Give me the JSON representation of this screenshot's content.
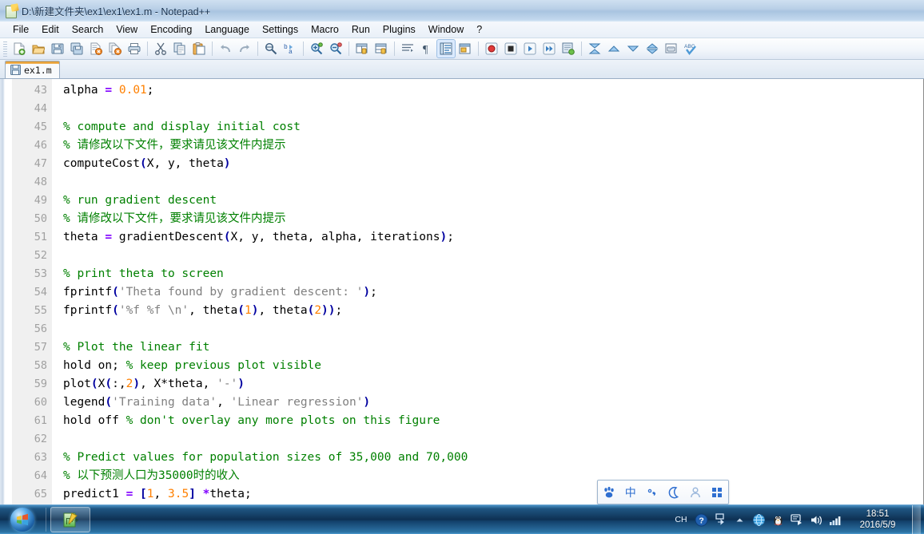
{
  "window": {
    "title": "D:\\新建文件夹\\ex1\\ex1\\ex1.m - Notepad++",
    "icon": "notepad-plus-plus-icon"
  },
  "menu": {
    "items": [
      {
        "label": "File"
      },
      {
        "label": "Edit"
      },
      {
        "label": "Search"
      },
      {
        "label": "View"
      },
      {
        "label": "Encoding"
      },
      {
        "label": "Language"
      },
      {
        "label": "Settings"
      },
      {
        "label": "Macro"
      },
      {
        "label": "Run"
      },
      {
        "label": "Plugins"
      },
      {
        "label": "Window"
      },
      {
        "label": "?"
      }
    ]
  },
  "toolbar": {
    "buttons": [
      {
        "name": "new-file-icon",
        "tip": "New"
      },
      {
        "name": "open-file-icon",
        "tip": "Open"
      },
      {
        "name": "save-icon",
        "tip": "Save"
      },
      {
        "name": "save-all-icon",
        "tip": "Save All"
      },
      {
        "name": "close-file-icon",
        "tip": "Close"
      },
      {
        "name": "close-all-icon",
        "tip": "Close All"
      },
      {
        "name": "print-icon",
        "tip": "Print"
      },
      {
        "name": "cut-icon",
        "tip": "Cut"
      },
      {
        "name": "copy-icon",
        "tip": "Copy"
      },
      {
        "name": "paste-icon",
        "tip": "Paste"
      },
      {
        "name": "undo-icon",
        "tip": "Undo"
      },
      {
        "name": "redo-icon",
        "tip": "Redo"
      },
      {
        "name": "find-icon",
        "tip": "Find"
      },
      {
        "name": "replace-icon",
        "tip": "Replace"
      },
      {
        "name": "zoom-in-icon",
        "tip": "Zoom In"
      },
      {
        "name": "zoom-out-icon",
        "tip": "Zoom Out"
      },
      {
        "name": "sync-vertical-icon",
        "tip": "Synchronize Vertical Scrolling"
      },
      {
        "name": "sync-horizontal-icon",
        "tip": "Synchronize Horizontal Scrolling"
      },
      {
        "name": "word-wrap-icon",
        "tip": "Word Wrap"
      },
      {
        "name": "show-all-chars-icon",
        "tip": "Show All Characters"
      },
      {
        "name": "indent-guide-icon",
        "tip": "Show Indent Guide"
      },
      {
        "name": "user-defined-dialog-icon",
        "tip": "User-Defined Dialogue"
      },
      {
        "name": "record-macro-icon",
        "tip": "Start Recording"
      },
      {
        "name": "stop-macro-icon",
        "tip": "Stop Recording"
      },
      {
        "name": "play-macro-icon",
        "tip": "Playback"
      },
      {
        "name": "run-macro-multiple-icon",
        "tip": "Run a Macro Multiple Times"
      },
      {
        "name": "save-macro-icon",
        "tip": "Save Current Recorded Macro"
      },
      {
        "name": "collapse-all-icon",
        "tip": "Collapse All"
      },
      {
        "name": "collapse-level-icon",
        "tip": "Collapse Current Level"
      },
      {
        "name": "uncollapse-level-icon",
        "tip": "Uncollapse Current Level"
      },
      {
        "name": "expand-all-icon",
        "tip": "Expand All"
      },
      {
        "name": "show-untitled-icon",
        "tip": "Show All Characters"
      },
      {
        "name": "spell-check-icon",
        "tip": "Spell Check"
      }
    ]
  },
  "tabs": [
    {
      "label": "ex1.m",
      "icon": "saved-file-icon",
      "active": true
    }
  ],
  "editor": {
    "first_line": 43,
    "lines": [
      {
        "num": "43",
        "tokens": [
          {
            "t": "alpha ",
            "c": "c-def"
          },
          {
            "t": "=",
            "c": "c-op"
          },
          {
            "t": " ",
            "c": "c-def"
          },
          {
            "t": "0.01",
            "c": "c-num"
          },
          {
            "t": ";",
            "c": "c-def"
          }
        ]
      },
      {
        "num": "44",
        "tokens": []
      },
      {
        "num": "45",
        "tokens": [
          {
            "t": "% compute and display initial cost",
            "c": "c-com"
          }
        ]
      },
      {
        "num": "46",
        "tokens": [
          {
            "t": "% 请修改以下文件，要求请见该文件内提示",
            "c": "c-com"
          }
        ]
      },
      {
        "num": "47",
        "tokens": [
          {
            "t": "computeCost",
            "c": "c-def"
          },
          {
            "t": "(",
            "c": "c-par"
          },
          {
            "t": "X, y, theta",
            "c": "c-def"
          },
          {
            "t": ")",
            "c": "c-par"
          }
        ]
      },
      {
        "num": "48",
        "tokens": []
      },
      {
        "num": "49",
        "tokens": [
          {
            "t": "% run gradient descent",
            "c": "c-com"
          }
        ]
      },
      {
        "num": "50",
        "tokens": [
          {
            "t": "% 请修改以下文件，要求请见该文件内提示",
            "c": "c-com"
          }
        ]
      },
      {
        "num": "51",
        "tokens": [
          {
            "t": "theta ",
            "c": "c-def"
          },
          {
            "t": "=",
            "c": "c-op"
          },
          {
            "t": " gradientDescent",
            "c": "c-def"
          },
          {
            "t": "(",
            "c": "c-par"
          },
          {
            "t": "X, y, theta, alpha, iterations",
            "c": "c-def"
          },
          {
            "t": ")",
            "c": "c-par"
          },
          {
            "t": ";",
            "c": "c-def"
          }
        ]
      },
      {
        "num": "52",
        "tokens": []
      },
      {
        "num": "53",
        "tokens": [
          {
            "t": "% print theta to screen",
            "c": "c-com"
          }
        ]
      },
      {
        "num": "54",
        "tokens": [
          {
            "t": "fprintf",
            "c": "c-def"
          },
          {
            "t": "(",
            "c": "c-par"
          },
          {
            "t": "'Theta found by gradient descent: '",
            "c": "c-str"
          },
          {
            "t": ")",
            "c": "c-par"
          },
          {
            "t": ";",
            "c": "c-def"
          }
        ]
      },
      {
        "num": "55",
        "tokens": [
          {
            "t": "fprintf",
            "c": "c-def"
          },
          {
            "t": "(",
            "c": "c-par"
          },
          {
            "t": "'%f %f \\n'",
            "c": "c-str"
          },
          {
            "t": ", theta",
            "c": "c-def"
          },
          {
            "t": "(",
            "c": "c-par"
          },
          {
            "t": "1",
            "c": "c-num"
          },
          {
            "t": ")",
            "c": "c-par"
          },
          {
            "t": ", theta",
            "c": "c-def"
          },
          {
            "t": "(",
            "c": "c-par"
          },
          {
            "t": "2",
            "c": "c-num"
          },
          {
            "t": ")",
            "c": "c-par"
          },
          {
            "t": ")",
            "c": "c-par"
          },
          {
            "t": ";",
            "c": "c-def"
          }
        ]
      },
      {
        "num": "56",
        "tokens": []
      },
      {
        "num": "57",
        "tokens": [
          {
            "t": "% Plot the linear fit",
            "c": "c-com"
          }
        ]
      },
      {
        "num": "58",
        "tokens": [
          {
            "t": "hold on; ",
            "c": "c-def"
          },
          {
            "t": "% keep previous plot visible",
            "c": "c-com"
          }
        ]
      },
      {
        "num": "59",
        "tokens": [
          {
            "t": "plot",
            "c": "c-def"
          },
          {
            "t": "(",
            "c": "c-par"
          },
          {
            "t": "X",
            "c": "c-def"
          },
          {
            "t": "(",
            "c": "c-par"
          },
          {
            "t": ":,",
            "c": "c-def"
          },
          {
            "t": "2",
            "c": "c-num"
          },
          {
            "t": ")",
            "c": "c-par"
          },
          {
            "t": ", X*theta, ",
            "c": "c-def"
          },
          {
            "t": "'-'",
            "c": "c-str"
          },
          {
            "t": ")",
            "c": "c-par"
          }
        ]
      },
      {
        "num": "60",
        "tokens": [
          {
            "t": "legend",
            "c": "c-def"
          },
          {
            "t": "(",
            "c": "c-par"
          },
          {
            "t": "'Training data'",
            "c": "c-str"
          },
          {
            "t": ", ",
            "c": "c-def"
          },
          {
            "t": "'Linear regression'",
            "c": "c-str"
          },
          {
            "t": ")",
            "c": "c-par"
          }
        ]
      },
      {
        "num": "61",
        "tokens": [
          {
            "t": "hold off ",
            "c": "c-def"
          },
          {
            "t": "% don't overlay any more plots on this figure",
            "c": "c-com"
          }
        ]
      },
      {
        "num": "62",
        "tokens": []
      },
      {
        "num": "63",
        "tokens": [
          {
            "t": "% Predict values for population sizes of 35,000 and 70,000",
            "c": "c-com"
          }
        ]
      },
      {
        "num": "64",
        "tokens": [
          {
            "t": "% 以下预测人口为35000时的收入",
            "c": "c-com"
          }
        ]
      },
      {
        "num": "65",
        "tokens": [
          {
            "t": "predict1 ",
            "c": "c-def"
          },
          {
            "t": "=",
            "c": "c-op"
          },
          {
            "t": " ",
            "c": "c-def"
          },
          {
            "t": "[",
            "c": "c-par"
          },
          {
            "t": "1",
            "c": "c-num"
          },
          {
            "t": ", ",
            "c": "c-def"
          },
          {
            "t": "3.5",
            "c": "c-num"
          },
          {
            "t": "]",
            "c": "c-par"
          },
          {
            "t": " ",
            "c": "c-def"
          },
          {
            "t": "*",
            "c": "c-op"
          },
          {
            "t": "theta;",
            "c": "c-def"
          }
        ]
      }
    ]
  },
  "ime_bar": {
    "buttons": [
      {
        "name": "baidu-paw-logo-icon",
        "label": "paw"
      },
      {
        "name": "chinese-mode-icon",
        "label": "中"
      },
      {
        "name": "punctuation-mode-icon",
        "label": "°,"
      },
      {
        "name": "moon-mode-icon",
        "label": "moon"
      },
      {
        "name": "user-icon",
        "label": "user"
      },
      {
        "name": "keyboard-grid-icon",
        "label": "grid"
      }
    ]
  },
  "taskbar": {
    "start_button": "start-orb",
    "items": [
      {
        "name": "taskbar-item-notepad-plus-plus",
        "label": "Notepad++"
      }
    ],
    "tray": [
      {
        "name": "language-indicator",
        "label": "CH"
      },
      {
        "name": "help-icon",
        "label": "?"
      },
      {
        "name": "ime-status-icon",
        "label": "ime"
      },
      {
        "name": "show-hidden-icons-chevron",
        "label": "^"
      },
      {
        "name": "browser-icon",
        "label": "browser"
      },
      {
        "name": "qq-penguin-icon",
        "label": "QQ"
      },
      {
        "name": "ime-tray-icon",
        "label": "ime2"
      },
      {
        "name": "volume-icon",
        "label": "volume"
      },
      {
        "name": "network-icon",
        "label": "network"
      }
    ],
    "clock": {
      "time": "18:51",
      "date": "2016/5/9"
    }
  }
}
